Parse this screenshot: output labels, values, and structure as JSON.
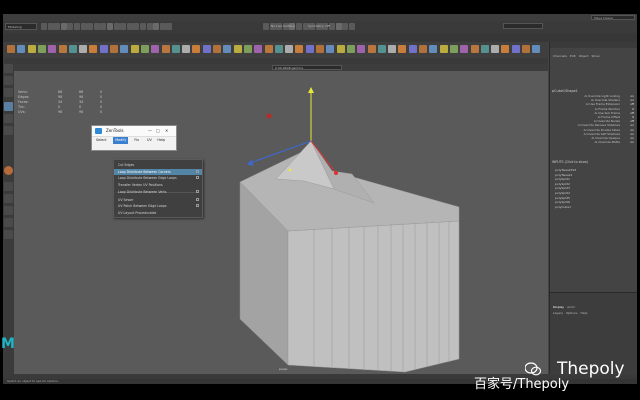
{
  "menubar": {
    "items": [
      "File",
      "Edit",
      "Create",
      "Select",
      "Modify",
      "Display",
      "Windows",
      "Mesh",
      "Edit Mesh",
      "Mesh Tools",
      "Mesh Display",
      "Curves",
      "Surfaces",
      "Deform",
      "UV",
      "Generate",
      "Cache",
      "Arnold",
      "Zen3D_ZenTools",
      "Help"
    ],
    "workspace": "Maya Classic"
  },
  "status_line": {
    "mode": "Modeling",
    "live_surface": "No Live Surface",
    "symmetry": "Symmetry: Off"
  },
  "shelf_tabs": [
    "Curves / Surfaces",
    "Poly Modeling",
    "Sculpting",
    "Rigging",
    "Animation",
    "Rendering",
    "FX",
    "FX Caching",
    "Custom",
    "Arnold",
    "Bifrost",
    "MASH",
    "Motion Graphics",
    "XGen"
  ],
  "panel_menu": [
    "View",
    "Shading",
    "Lighting",
    "Show",
    "Renderer",
    "Panels"
  ],
  "camera": {
    "field": "0.00  sRGB gamma",
    "label": "persp"
  },
  "heads_up": {
    "rows": [
      {
        "label": "Verts:",
        "a": "86",
        "b": "86",
        "c": "0"
      },
      {
        "label": "Edges:",
        "a": "98",
        "b": "98",
        "c": "0"
      },
      {
        "label": "Faces:",
        "a": "34",
        "b": "34",
        "c": "0"
      },
      {
        "label": "Tris:",
        "a": "0",
        "b": "0",
        "c": "0"
      },
      {
        "label": "UVs:",
        "a": "96",
        "b": "96",
        "c": "0"
      }
    ]
  },
  "channel_box": {
    "menu": [
      "Channels",
      "Edit",
      "Object",
      "Show"
    ],
    "object": "pCube1Shape1",
    "attributes": [
      {
        "label": "Ai Override Light Linking",
        "value": "on"
      },
      {
        "label": "Ai Override Shaders",
        "value": "on"
      },
      {
        "label": "Ai Use Frame Extension",
        "value": "off"
      },
      {
        "label": "Ai Frame Number",
        "value": "0"
      },
      {
        "label": "Ai Use Sub Frame",
        "value": "off"
      },
      {
        "label": "Ai Frame Offset",
        "value": "0"
      },
      {
        "label": "Ai Override Nodes",
        "value": "off"
      },
      {
        "label": "Ai Override Receive Shadows",
        "value": "on"
      },
      {
        "label": "Ai Override Double Sided",
        "value": "on"
      },
      {
        "label": "Ai Override Self Shadows",
        "value": "on"
      },
      {
        "label": "Ai Override Opaque",
        "value": "on"
      },
      {
        "label": "Ai Override Matte",
        "value": "on"
      }
    ],
    "inputs_title": "INPUTS",
    "inputs_hint": "(Click to show)",
    "input_nodes": [
      "polyTweak393",
      "polyTweak1",
      "polySplit1",
      "polySplit2",
      "polySplit3",
      "polySplit4",
      "polySplit5",
      "polySplit6",
      "polyCube1"
    ]
  },
  "layer_editor": {
    "tabs": [
      "Display",
      "Anim"
    ],
    "menu": [
      "Layers",
      "Options",
      "Help"
    ]
  },
  "zentools": {
    "title": "ZenTools",
    "minimize": "—",
    "maximize": "□",
    "close": "✕",
    "menu": [
      "Select",
      "Modify",
      "Fix",
      "UV",
      "Help"
    ],
    "active_menu": "Modify"
  },
  "dropdown": {
    "items": [
      {
        "label": "Cut Edges",
        "checkbox": false,
        "highlight": false
      },
      {
        "label": "Loop Distribute Between Corners",
        "checkbox": true,
        "highlight": true
      },
      {
        "label": "Loop Distribute Between Edge Loops",
        "checkbox": true,
        "highlight": false
      },
      {
        "label": "Transfer Vertex UV Positions",
        "checkbox": false,
        "highlight": false
      },
      {
        "label": "Loop Distribute Between Verts",
        "checkbox": true,
        "highlight": false
      },
      {
        "label": "UV Sewer",
        "checkbox": true,
        "highlight": false
      },
      {
        "label": "UV Patch Between Edge Loops",
        "checkbox": true,
        "highlight": false
      },
      {
        "label": "UV Layout ProceduraIde",
        "checkbox": false,
        "highlight": false
      }
    ]
  },
  "help_line": "Select an object to see its options.",
  "watermark": {
    "name": "Thepoly",
    "sub": "百家号/Thepoly"
  },
  "maya_logo": "M",
  "colors": {
    "accent": "#5285a6",
    "viewport_bg": "#5a5a5a",
    "maya_logo": "#1fb5c3",
    "gizmo_y": "#e8e83a",
    "gizmo_x": "#e03030",
    "gizmo_z": "#3a6ad8"
  }
}
